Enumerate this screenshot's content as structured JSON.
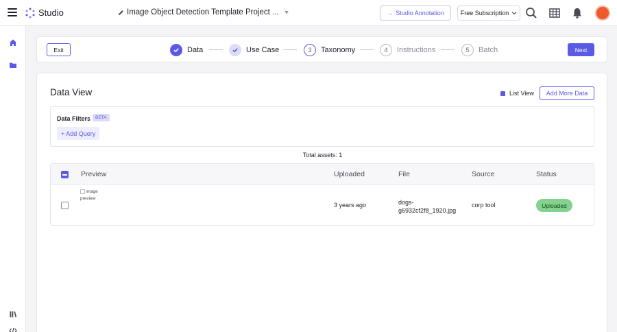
{
  "topbar": {
    "brand": "Studio",
    "project_title": "Image Object Detection Template Project ...",
    "studio_annotation_label": "Studio Annotation",
    "subscription_label": "Free Subscription"
  },
  "stepper": {
    "exit_label": "Exit",
    "next_label": "Next",
    "steps": [
      {
        "number": "1",
        "label": "Data",
        "state": "completed"
      },
      {
        "number": "2",
        "label": "Use Case",
        "state": "completed"
      },
      {
        "number": "3",
        "label": "Taxonomy",
        "state": "current"
      },
      {
        "number": "4",
        "label": "Instructions",
        "state": "upcoming"
      },
      {
        "number": "5",
        "label": "Batch",
        "state": "upcoming"
      }
    ]
  },
  "data_view": {
    "title": "Data View",
    "list_view_label": "List View",
    "add_more_label": "Add More Data",
    "filters_label": "Data Filters",
    "beta_badge": "BETA",
    "add_query_label": "+ Add Query",
    "total_assets": "Total assets: 1"
  },
  "table": {
    "columns": [
      "Preview",
      "Uploaded",
      "File",
      "Source",
      "Status"
    ],
    "rows": [
      {
        "preview_alt": "image preview",
        "uploaded": "3 years ago",
        "file_line1": "dogs-",
        "file_line2": "g6932cf2f8_1920.jpg",
        "source": "corp tool",
        "status": "Uploaded"
      }
    ]
  },
  "colors": {
    "accent": "#5a5ae6",
    "status_uploaded": "#84d28e",
    "avatar": "#ef5a2a"
  }
}
